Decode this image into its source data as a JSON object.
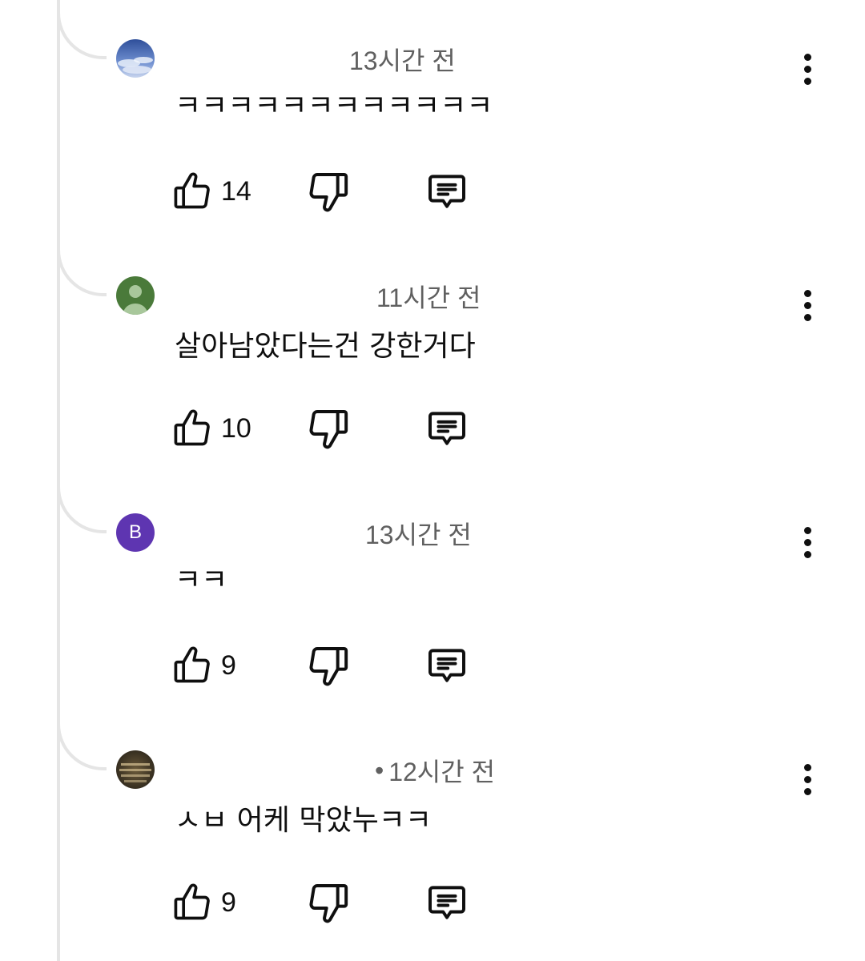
{
  "comments": [
    {
      "author": "",
      "time": "13시간 전",
      "text": "ㅋㅋㅋㅋㅋㅋㅋㅋㅋㅋㅋㅋ",
      "likes": "14",
      "avatar": {
        "kind": "sky-photo"
      }
    },
    {
      "author": "",
      "time": "11시간 전",
      "text": "살아남았다는건 강한거다",
      "likes": "10",
      "avatar": {
        "kind": "default-person",
        "color": "#4a7a3a"
      }
    },
    {
      "author": "",
      "time": "13시간 전",
      "text": "ㅋㅋ",
      "likes": "9",
      "avatar": {
        "kind": "letter",
        "letter": "B",
        "color": "#5e35b1"
      }
    },
    {
      "author": "",
      "time": "12시간 전",
      "text": "ㅅㅂ 어케 막았누ㅋㅋ",
      "likes": "9",
      "avatar": {
        "kind": "book-cover-photo"
      }
    }
  ],
  "separator": "•",
  "icons": {
    "like": "thumbs-up-icon",
    "dislike": "thumbs-down-icon",
    "reply": "comment-reply-icon",
    "more": "more-vertical-icon"
  }
}
